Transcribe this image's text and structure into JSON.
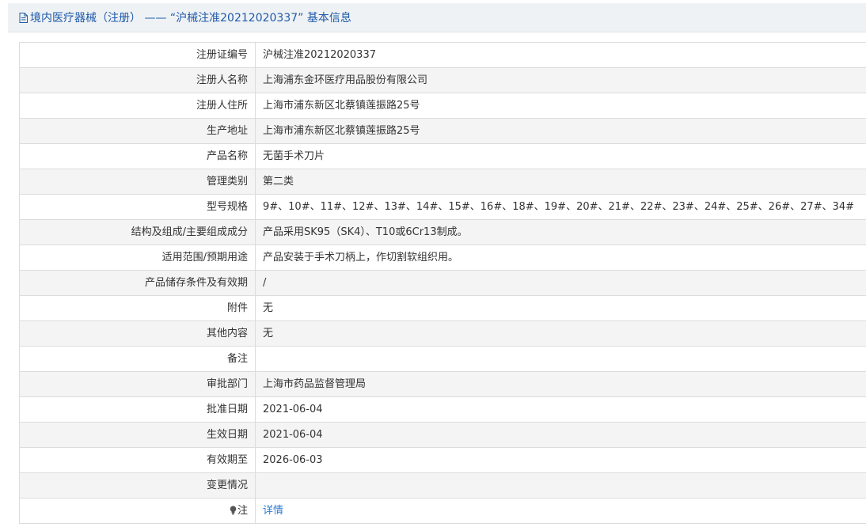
{
  "header": {
    "title": "境内医疗器械（注册） —— “沪械注准20212020337” 基本信息"
  },
  "rows": [
    {
      "label": "注册证编号",
      "value": "沪械注准20212020337"
    },
    {
      "label": "注册人名称",
      "value": "上海浦东金环医疗用品股份有限公司"
    },
    {
      "label": "注册人住所",
      "value": "上海市浦东新区北蔡镇莲振路25号"
    },
    {
      "label": "生产地址",
      "value": "上海市浦东新区北蔡镇莲振路25号"
    },
    {
      "label": "产品名称",
      "value": "无菌手术刀片"
    },
    {
      "label": "管理类别",
      "value": "第二类"
    },
    {
      "label": "型号规格",
      "value": "9#、10#、11#、12#、13#、14#、15#、16#、18#、19#、20#、21#、22#、23#、24#、25#、26#、27#、34#"
    },
    {
      "label": "结构及组成/主要组成成分",
      "value": "产品采用SK95（SK4）、T10或6Cr13制成。"
    },
    {
      "label": "适用范围/预期用途",
      "value": "产品安装于手术刀柄上，作切割软组织用。"
    },
    {
      "label": "产品储存条件及有效期",
      "value": "/"
    },
    {
      "label": "附件",
      "value": "无"
    },
    {
      "label": "其他内容",
      "value": "无"
    },
    {
      "label": "备注",
      "value": ""
    },
    {
      "label": "审批部门",
      "value": "上海市药品监督管理局"
    },
    {
      "label": "批准日期",
      "value": "2021-06-04"
    },
    {
      "label": "生效日期",
      "value": "2021-06-04"
    },
    {
      "label": "有效期至",
      "value": "2026-06-03"
    },
    {
      "label": "变更情况",
      "value": ""
    }
  ],
  "note": {
    "label": "注",
    "link": "详情",
    "icon": "lightbulb-icon"
  },
  "colors": {
    "header_text": "#1e59a8",
    "header_bg": "#eff2f5",
    "link": "#2b7bd3",
    "border": "#dcdcdc",
    "stripe": "#f4f4f4"
  }
}
